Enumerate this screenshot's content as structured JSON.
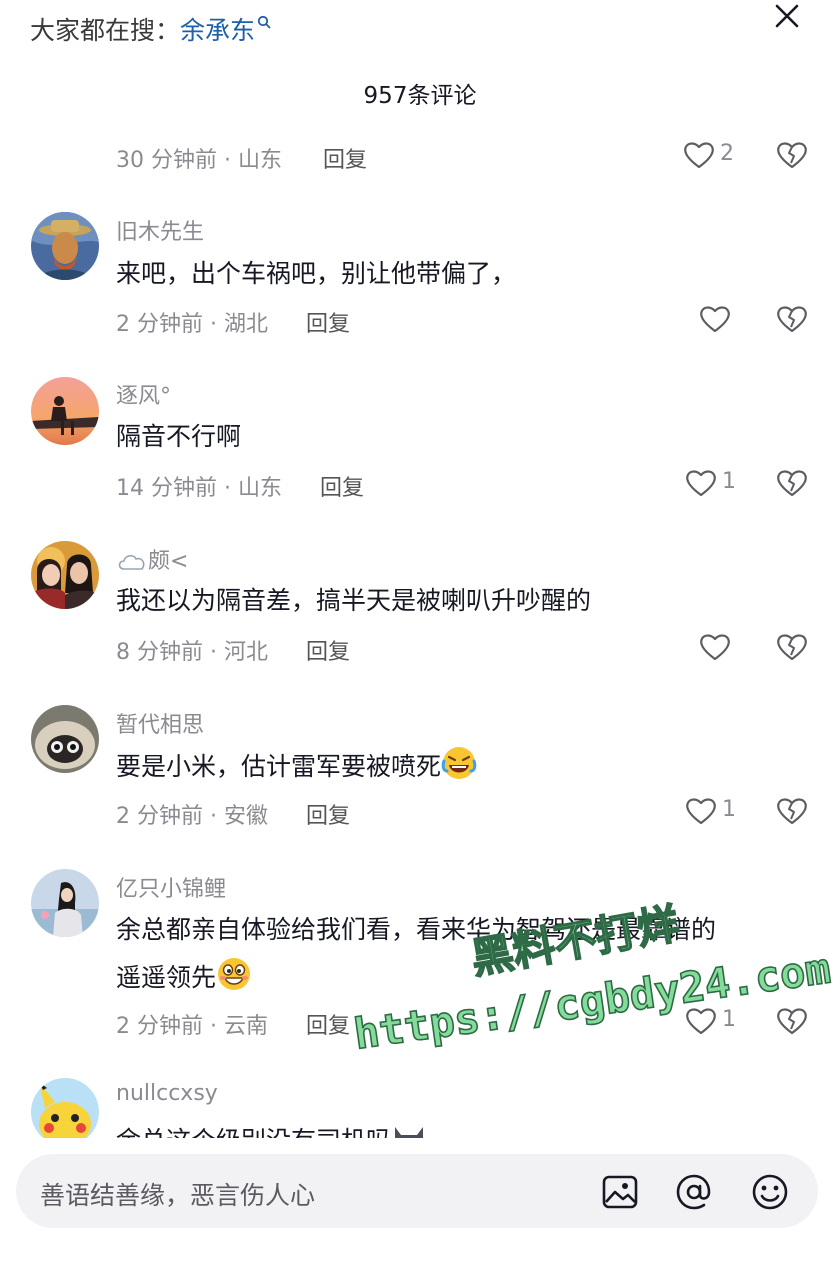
{
  "header": {
    "hot_search_label": "大家都在搜：",
    "hot_search_keyword": "余承东",
    "comment_count": "957条评论"
  },
  "comments": [
    {
      "meta": "30 分钟前 · 山东",
      "reply": "回复",
      "likes": "2"
    },
    {
      "username": "旧木先生",
      "text": "来吧，出个车祸吧，别让他带偏了，",
      "meta": "2 分钟前 · 湖北",
      "reply": "回复",
      "likes": ""
    },
    {
      "username": "逐风°",
      "text": "隔音不行啊",
      "meta": "14 分钟前 · 山东",
      "reply": "回复",
      "likes": "1"
    },
    {
      "username": "颇<",
      "text": "我还以为隔音差，搞半天是被喇叭升吵醒的",
      "meta": "8 分钟前 · 河北",
      "reply": "回复",
      "likes": ""
    },
    {
      "username": "暂代相思",
      "text": "要是小米，估计雷军要被喷死",
      "meta": "2 分钟前 · 安徽",
      "reply": "回复",
      "likes": "1"
    },
    {
      "username": "亿只小锦鲤",
      "text_line1": "余总都亲自体验给我们看，看来华为智驾还是最靠谱的",
      "text_line2": "遥遥领先",
      "meta": "2 分钟前 · 云南",
      "reply": "回复",
      "likes": "1"
    },
    {
      "username": "nullccxsy",
      "text": "余总这个级别没有司机吗"
    }
  ],
  "watermark": {
    "line1": "黑料不打烊",
    "line2": "https://cgbdy24.com"
  },
  "input": {
    "placeholder": "善语结善缘，恶言伤人心"
  },
  "icons": [
    "search-icon",
    "close-icon",
    "heart-icon",
    "dislike-heart-icon",
    "cloud-icon",
    "image-icon",
    "at-icon",
    "emoji-icon"
  ]
}
